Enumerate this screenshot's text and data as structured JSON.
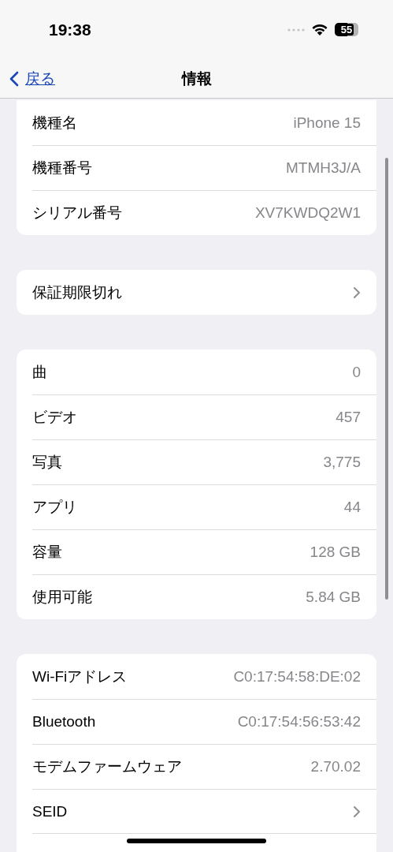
{
  "status_bar": {
    "time": "19:38",
    "battery": "55"
  },
  "nav": {
    "back": "戻る",
    "title": "情報"
  },
  "sections": [
    {
      "rows": [
        {
          "kind": "value",
          "label": "機種名",
          "value": "iPhone 15"
        },
        {
          "kind": "value",
          "label": "機種番号",
          "value": "MTMH3J/A"
        },
        {
          "kind": "value",
          "label": "シリアル番号",
          "value": "XV7KWDQ2W1"
        }
      ]
    },
    {
      "rows": [
        {
          "kind": "link",
          "label": "保証期限切れ"
        }
      ]
    },
    {
      "rows": [
        {
          "kind": "value",
          "label": "曲",
          "value": "0"
        },
        {
          "kind": "value",
          "label": "ビデオ",
          "value": "457"
        },
        {
          "kind": "value",
          "label": "写真",
          "value": "3,775"
        },
        {
          "kind": "value",
          "label": "アプリ",
          "value": "44"
        },
        {
          "kind": "value",
          "label": "容量",
          "value": "128 GB"
        },
        {
          "kind": "value",
          "label": "使用可能",
          "value": "5.84 GB"
        }
      ]
    },
    {
      "rows": [
        {
          "kind": "value",
          "label": "Wi-Fiアドレス",
          "value": "C0:17:54:58:DE:02"
        },
        {
          "kind": "value",
          "label": "Bluetooth",
          "value": "C0:17:54:56:53:42"
        },
        {
          "kind": "value",
          "label": "モデムファームウェア",
          "value": "2.70.02"
        },
        {
          "kind": "link",
          "label": "SEID"
        }
      ]
    }
  ]
}
